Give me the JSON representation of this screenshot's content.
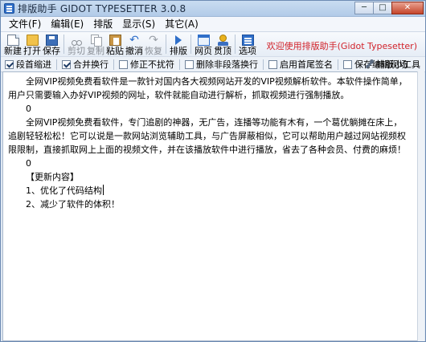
{
  "window": {
    "title": "排版助手 GIDOT TYPESETTER 3.0.8",
    "minimize_glyph": "─",
    "maximize_glyph": "□",
    "close_glyph": "✕"
  },
  "menu": {
    "items": [
      "文件(F)",
      "编辑(E)",
      "排版",
      "显示(S)",
      "其它(A)"
    ]
  },
  "toolbar": {
    "new": "新建",
    "open": "打开",
    "save": "保存",
    "cut": "剪切",
    "copy": "复制",
    "paste": "粘贴",
    "undo": "撤消",
    "redo": "恢复",
    "typeset": "排版",
    "web": "网页",
    "gold": "贯顶",
    "options": "选项",
    "welcome": "欢迎使用排版助手(Gidot Typesetter)",
    "undo_glyph": "↶",
    "redo_glyph": "↷"
  },
  "options": {
    "indent": {
      "label": "段首缩进",
      "checked": true
    },
    "merge": {
      "label": "合并换行",
      "checked": true
    },
    "fix_breaks": {
      "label": "修正不扰符",
      "checked": false
    },
    "remove_empty": {
      "label": "删除非段落换行",
      "checked": false
    },
    "footer_sign": {
      "label": "启用首尾签名",
      "checked": false
    },
    "save_state": {
      "label": "保存编辑现场",
      "checked": false
    },
    "tools": "排版小工具"
  },
  "editor": {
    "para1": "全网VIP视频免费看软件是一款针对国内各大视频网站开发的VIP视频解析软件。本软件操作简单，用户只需要输入办好VIP视频的网址，软件就能自动进行解析，抓取视频进行强制播放。",
    "zero1": "0",
    "para2": "全网VIP视频免费看软件，专门追剧的神器，无广告，连播等功能有木有，一个葛优躺摊在床上，追剧轻轻松松！它可以说是一款网站浏览辅助工具，与广告屏蔽相似，它可以帮助用户越过网站视频权限限制，直接抓取网上上面的视频文件，并在该播放软件中进行播放，省去了各种会员、付费的麻烦！",
    "zero2": "0",
    "update_header": "【更新内容】",
    "update1": "1、优化了代码结构",
    "update2": "2、减少了软件的体积！"
  }
}
